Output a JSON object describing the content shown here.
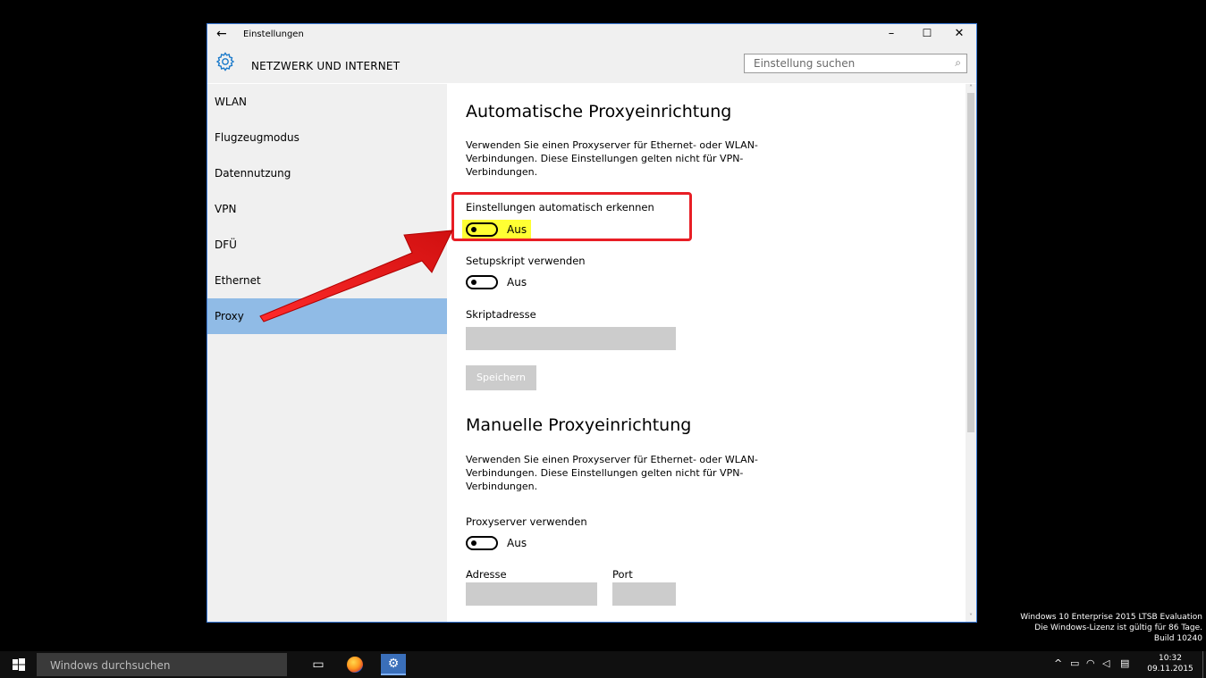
{
  "window": {
    "back_glyph": "←",
    "title": "Einstellungen",
    "minimize": "–",
    "maximize": "☐",
    "close": "✕"
  },
  "header": {
    "section_title": "NETZWERK UND INTERNET",
    "search_placeholder": "Einstellung suchen",
    "icon": "gear-icon"
  },
  "sidebar": {
    "items": [
      {
        "label": "WLAN"
      },
      {
        "label": "Flugzeugmodus"
      },
      {
        "label": "Datennutzung"
      },
      {
        "label": "VPN"
      },
      {
        "label": "DFÜ"
      },
      {
        "label": "Ethernet"
      },
      {
        "label": "Proxy",
        "active": true
      }
    ]
  },
  "auto_proxy": {
    "heading": "Automatische Proxyeinrichtung",
    "description": "Verwenden Sie einen Proxyserver für Ethernet- oder WLAN-Verbindungen. Diese Einstellungen gelten nicht für VPN-Verbindungen.",
    "auto_detect_label": "Einstellungen automatisch erkennen",
    "auto_detect_state": "Aus",
    "setup_script_label": "Setupskript verwenden",
    "setup_script_state": "Aus",
    "script_address_label": "Skriptadresse",
    "script_address_value": "",
    "save_button": "Speichern"
  },
  "manual_proxy": {
    "heading": "Manuelle Proxyeinrichtung",
    "description": "Verwenden Sie einen Proxyserver für Ethernet- oder WLAN-Verbindungen. Diese Einstellungen gelten nicht für VPN-Verbindungen.",
    "use_proxy_label": "Proxyserver verwenden",
    "use_proxy_state": "Aus",
    "address_label": "Adresse",
    "port_label": "Port",
    "address_value": "",
    "port_value": ""
  },
  "watermark": {
    "line1": "Windows 10 Enterprise 2015 LTSB Evaluation",
    "line2": "Die Windows-Lizenz ist gültig für 86 Tage.",
    "line3": "Build 10240"
  },
  "taskbar": {
    "search_placeholder": "Windows durchsuchen",
    "time": "10:32",
    "date": "09.11.2015"
  },
  "colors": {
    "accent": "#1979ca",
    "selected_nav": "#90bbe6",
    "annotation_red": "#e81e25",
    "highlight_yellow": "#ffff33"
  }
}
